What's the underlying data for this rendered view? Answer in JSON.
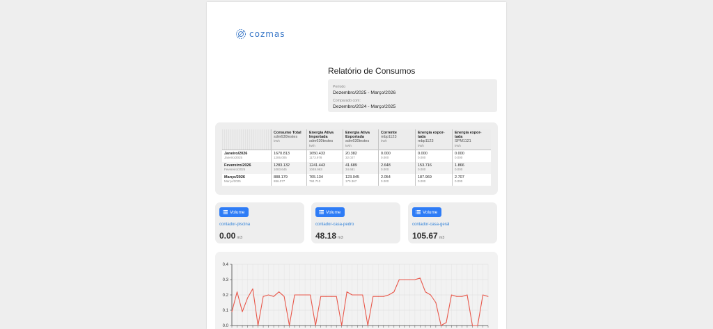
{
  "logo": {
    "text": "cozmas"
  },
  "report": {
    "title": "Relatório de Consumos",
    "period_label": "Período",
    "period_value": "Dezembro/2025 - Março/2026",
    "compared_label": "Comparado com:",
    "compared_value": "Dezembro/2024 - Março/2025"
  },
  "table": {
    "columns": [
      {
        "title": "Consumo Total",
        "sub": "sdm630testes",
        "unit": "kWh"
      },
      {
        "title": "Energia Ativa Importada",
        "sub": "sdm630testes",
        "unit": "kWh"
      },
      {
        "title": "Energia Ativa Exportada",
        "sub": "sdm630testes",
        "unit": "kWh"
      },
      {
        "title": "Corrente",
        "sub": "mbp1123",
        "unit": "kWh"
      },
      {
        "title": "Energia expor-tada",
        "sub": "mbp1123",
        "unit": "kWh"
      },
      {
        "title": "Energia expor-tada",
        "sub": "SPM1121",
        "unit": "kWh"
      }
    ],
    "rows": [
      {
        "month": "Janeiro/2026",
        "compare": "Janeiro/2025",
        "values": [
          "1670.813",
          "1650.433",
          "20.382",
          "0.000",
          "0.000",
          "0.000"
        ],
        "compare_values": [
          "1206.005",
          "1173.978",
          "32.027",
          "0.000",
          "0.000",
          "0.000"
        ]
      },
      {
        "month": "Fevereiro/2026",
        "compare": "Fevereiro/2025",
        "values": [
          "1283.132",
          "1241.443",
          "41.689",
          "2.648",
          "153.716",
          "1.866"
        ],
        "compare_values": [
          "1083.645",
          "1048.963",
          "34.681",
          "0.000",
          "0.000",
          "0.000"
        ]
      },
      {
        "month": "Março/2026",
        "compare": "Março/2025",
        "values": [
          "888.179",
          "765.134",
          "123.045",
          "2.054",
          "187.969",
          "2.707"
        ],
        "compare_values": [
          "886.077",
          "784.710",
          "170.367",
          "0.000",
          "0.000",
          "0.000"
        ]
      }
    ]
  },
  "volumes": [
    {
      "button": "Volume",
      "name": "contador-piscina",
      "value": "0.00",
      "unit": "m3"
    },
    {
      "button": "Volume",
      "name": "contador-casa-pedro",
      "value": "48.18",
      "unit": "m3"
    },
    {
      "button": "Volume",
      "name": "contador-casa-geral",
      "value": "105.67",
      "unit": "m3"
    }
  ],
  "chart_data": {
    "type": "line",
    "title": "",
    "xlabel": "",
    "ylabel": "",
    "ylim": [
      0,
      0.4
    ],
    "yticks": [
      "0.4",
      "0.3",
      "0.2",
      "0.1",
      "0.0"
    ],
    "grid": true,
    "color": "#e8574a",
    "series": [
      {
        "values": [
          0.09,
          0.22,
          0.09,
          0.18,
          0.24,
          0.0,
          0.19,
          0.2,
          0.19,
          0.22,
          0.19,
          0.0,
          0.2,
          0.2,
          0.2,
          0.2,
          0.0,
          0.19,
          0.19,
          0.19,
          0.19,
          0.0,
          0.22,
          0.2,
          0.2,
          0.2,
          0.0,
          0.19,
          0.19,
          0.19,
          0.2,
          0.22,
          0.3,
          0.3,
          0.3,
          0.3,
          0.31,
          0.22,
          0.2,
          0.15,
          0.0,
          0.02,
          0.2,
          0.19,
          0.19,
          0.2,
          0.0,
          0.0,
          0.2,
          0.19
        ]
      }
    ]
  }
}
